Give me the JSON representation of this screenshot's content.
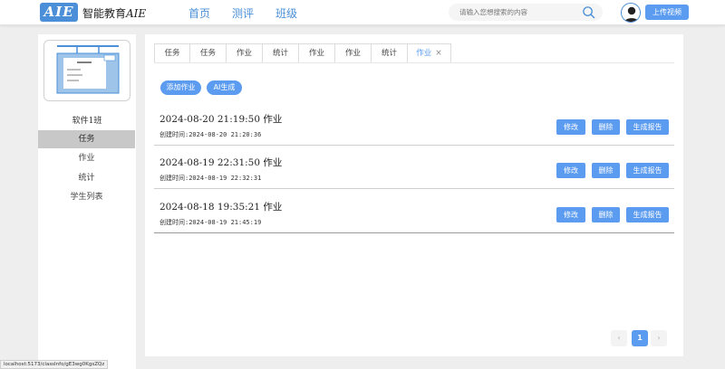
{
  "header": {
    "logo_text": "AIE",
    "brand_prefix": "智能教育",
    "brand_suffix": "AIE",
    "nav": [
      "首页",
      "测评",
      "班级"
    ],
    "search_placeholder": "请输入您想搜索的内容",
    "upload_label": "上传视频"
  },
  "sidebar": {
    "class_name": "软件1班",
    "items": [
      "任务",
      "作业",
      "统计",
      "学生列表"
    ],
    "active_index": 0
  },
  "tabs": [
    {
      "label": "任务"
    },
    {
      "label": "任务"
    },
    {
      "label": "作业"
    },
    {
      "label": "统计"
    },
    {
      "label": "作业"
    },
    {
      "label": "作业"
    },
    {
      "label": "统计"
    },
    {
      "label": "作业",
      "active": true,
      "closable": true,
      "close_glyph": "×"
    }
  ],
  "actions": {
    "add_homework": "添加作业",
    "ai_generate": "AI生成"
  },
  "homework_rows": [
    {
      "title": "2024-08-20 21:19:50 作业",
      "created": "创建时间:2024-08-20 21:20:36"
    },
    {
      "title": "2024-08-19 22:31:50 作业",
      "created": "创建时间:2024-08-19 22:32:31"
    },
    {
      "title": "2024-08-18 19:35:21 作业",
      "created": "创建时间:2024-08-19 21:45:19"
    }
  ],
  "row_actions": {
    "edit": "修改",
    "delete": "删除",
    "report": "生成报告"
  },
  "pagination": {
    "prev": "‹",
    "current": "1",
    "next": "›"
  },
  "status_url": "localhost:5173/classInfo/gE3wg0KgsZQz",
  "colors": {
    "accent": "#5b9bf0",
    "logo": "#4a8fd8",
    "active_sidebar": "#c8c8c8"
  }
}
